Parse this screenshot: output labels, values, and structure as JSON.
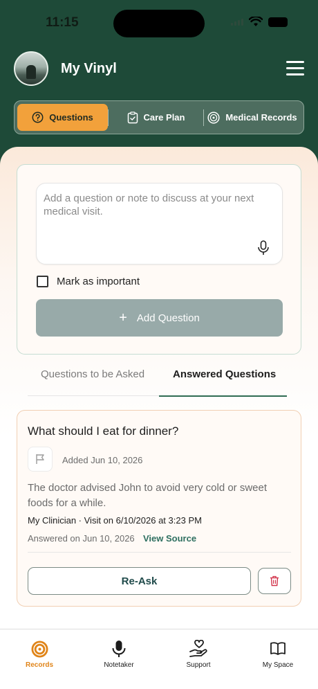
{
  "status_bar": {
    "time": "11:15"
  },
  "header": {
    "title": "My Vinyl"
  },
  "tabs": [
    {
      "label": "Questions",
      "icon": "question-circle-icon"
    },
    {
      "label": "Care Plan",
      "icon": "clipboard-check-icon"
    },
    {
      "label": "Medical Records",
      "icon": "records-disc-icon"
    }
  ],
  "form": {
    "placeholder": "Add a question or note to discuss at your next medical visit.",
    "mark_important_label": "Mark as important",
    "add_button_label": "Add Question"
  },
  "question_tabs": {
    "todo": "Questions to be Asked",
    "answered": "Answered Questions"
  },
  "question_card": {
    "title": "What should I eat for dinner?",
    "added": "Added Jun 10, 2026",
    "answer": "The doctor advised John to avoid very cold or sweet foods for a while.",
    "clinician": "My Clinician · Visit on 6/10/2026 at 3:23 PM",
    "answered_on": "Answered on Jun 10, 2026",
    "view_source": "View Source",
    "reask_label": "Re-Ask"
  },
  "bottom_nav": [
    {
      "label": "Records",
      "icon": "records-icon"
    },
    {
      "label": "Notetaker",
      "icon": "microphone-icon"
    },
    {
      "label": "Support",
      "icon": "support-heart-hand-icon"
    },
    {
      "label": "My Space",
      "icon": "book-icon"
    }
  ],
  "colors": {
    "header_bg": "#1e4a38",
    "accent": "#f2a13b",
    "active_nav": "#e08418"
  }
}
